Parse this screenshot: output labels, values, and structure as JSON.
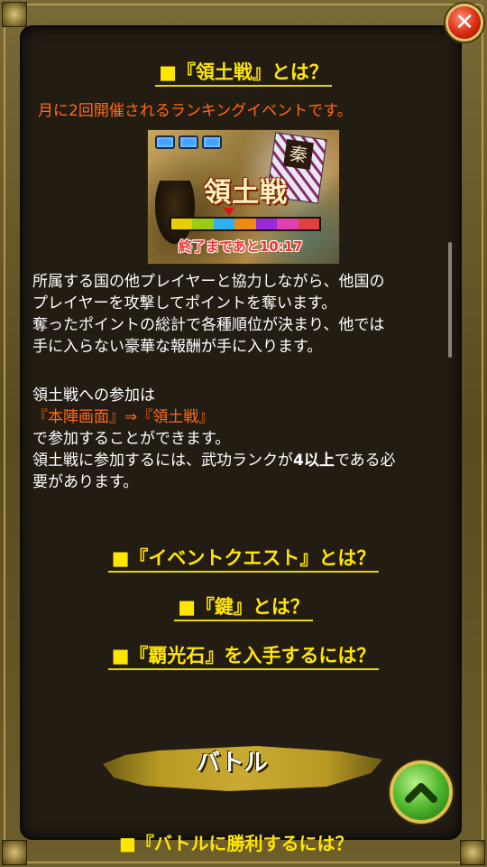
{
  "close_button": {
    "label": "✕",
    "icon": "close-icon"
  },
  "section_title": "■『領土戦』とは？",
  "intro_text": "月に2回開催されるランキングイベントです。",
  "banner": {
    "title": "領土戦",
    "timer": "終了まであと10:17",
    "flag_char": "秦",
    "progress_colors": [
      "#e8d000",
      "#9acd10",
      "#2fb0f0",
      "#f08a10",
      "#9a2ad8",
      "#e040b0",
      "#e04040"
    ]
  },
  "description": [
    "所属する国の他プレイヤーと協力しながら、他国の",
    "プレイヤーを攻撃してポイントを奪います。",
    "奪ったポイントの総計で各種順位が決まり、他では",
    "手に入らない豪華な報酬が手に入ります。"
  ],
  "participation": {
    "line1": "領土戦への参加は",
    "path": "『本陣画面』⇒『領土戦』",
    "line3": "で参加することができます。",
    "line4_pre": "領土戦に参加するには、武功ランクが",
    "line4_bold": "4以上",
    "line4_post": "である必",
    "line5": "要があります。"
  },
  "links": [
    "■『イベントクエスト』とは？",
    "■『鍵』とは？",
    "■『覇光石』を入手するには？"
  ],
  "battle_section": {
    "label": "バトル"
  },
  "cut_heading": "■『バトルに勝利するには？",
  "scroll_top_button": {
    "icon": "chevron-up-icon"
  }
}
